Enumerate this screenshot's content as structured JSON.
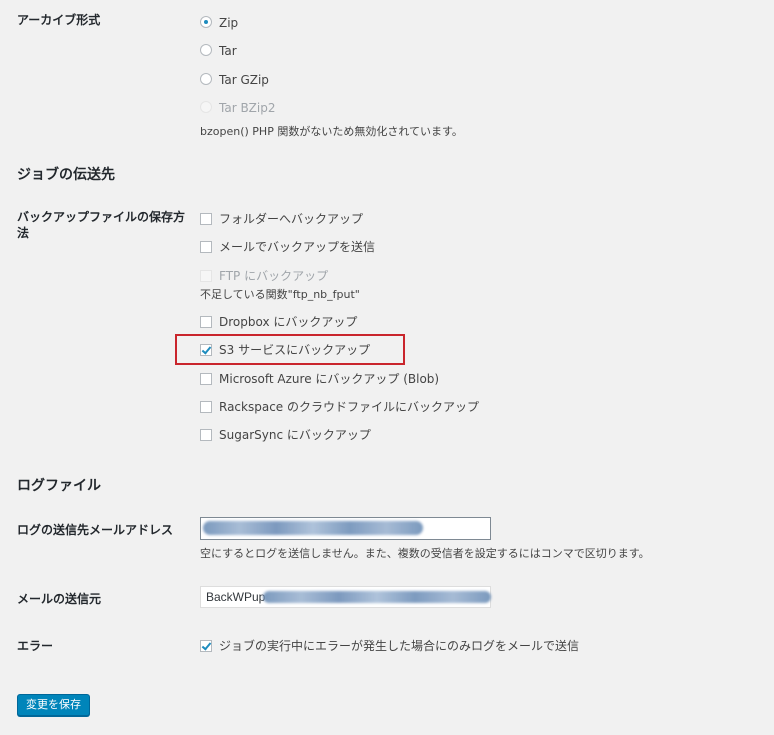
{
  "archive": {
    "label": "アーカイブ形式",
    "options": [
      {
        "label": "Zip",
        "checked": true,
        "disabled": false
      },
      {
        "label": "Tar",
        "checked": false,
        "disabled": false
      },
      {
        "label": "Tar GZip",
        "checked": false,
        "disabled": false
      },
      {
        "label": "Tar BZip2",
        "checked": false,
        "disabled": true
      }
    ],
    "note": "bzopen() PHP 関数がないため無効化されています。"
  },
  "destination": {
    "section_title": "ジョブの伝送先",
    "label": "バックアップファイルの保存方法",
    "options": [
      {
        "label": "フォルダーへバックアップ",
        "checked": false,
        "disabled": false
      },
      {
        "label": "メールでバックアップを送信",
        "checked": false,
        "disabled": false
      },
      {
        "label": "FTP にバックアップ",
        "checked": false,
        "disabled": true
      },
      {
        "label": "Dropbox にバックアップ",
        "checked": false,
        "disabled": false
      },
      {
        "label": "S3 サービスにバックアップ",
        "checked": true,
        "disabled": false
      },
      {
        "label": "Microsoft Azure にバックアップ (Blob)",
        "checked": false,
        "disabled": false
      },
      {
        "label": "Rackspace のクラウドファイルにバックアップ",
        "checked": false,
        "disabled": false
      },
      {
        "label": "SugarSync にバックアップ",
        "checked": false,
        "disabled": false
      }
    ],
    "ftp_note": "不足している関数\"ftp_nb_fput\""
  },
  "logfile": {
    "section_title": "ログファイル",
    "email_label": "ログの送信先メールアドレス",
    "email_hint": "空にするとログを送信しません。また、複数の受信者を設定するにはコンマで区切ります。",
    "sender_label": "メールの送信元",
    "sender_value": "BackWPup",
    "error_label": "エラー",
    "error_option": "ジョブの実行中にエラーが発生した場合にのみログをメールで送信",
    "error_checked": true
  },
  "save_button": "変更を保存",
  "colors": {
    "accent": "#0085ba",
    "highlight": "#c9252c"
  }
}
